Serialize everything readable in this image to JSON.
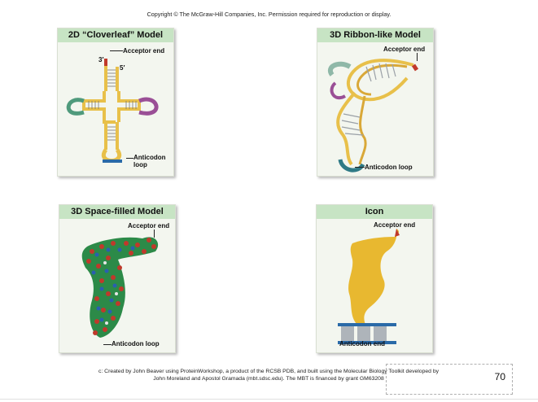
{
  "header": {
    "copyright": "Copyright © The McGraw-Hill Companies, Inc. Permission required for reproduction or display."
  },
  "panels": {
    "cloverleaf": {
      "title": "2D “Cloverleaf” Model",
      "acceptor_label": "Acceptor end",
      "three_prime": "3′",
      "five_prime": "5′",
      "anticodon_label_1": "Anticodon",
      "anticodon_label_2": "loop"
    },
    "ribbon": {
      "title": "3D Ribbon-like Model",
      "acceptor_label": "Acceptor end",
      "anticodon_label": "Anticodon loop"
    },
    "spacefill": {
      "title": "3D Space-filled Model",
      "acceptor_label": "Acceptor end",
      "anticodon_label": "Anticodon loop"
    },
    "icon": {
      "title": "Icon",
      "acceptor_label": "Acceptor end",
      "anticodon_label": "Anticodon end"
    }
  },
  "footer": {
    "credit_line_1": "c: Created by John Beaver using ProteinWorkshop, a product of the RCSB PDB, and built using the Molecular Biology Toolkit developed by",
    "credit_line_2": "John Moreland and Apostol Gramada (mbt.sdsc.edu). The MBT is financed by grant GM63208",
    "page_number": "70"
  },
  "colors": {
    "panel_header": "#c7e4c4",
    "panel_bg": "#f3f6ef",
    "stem_gold": "#e8c04a",
    "loop_green": "#4f9a7c",
    "loop_purple": "#9a4f96",
    "anticodon_blue": "#2a6aa8",
    "acceptor_red": "#c0392b"
  }
}
